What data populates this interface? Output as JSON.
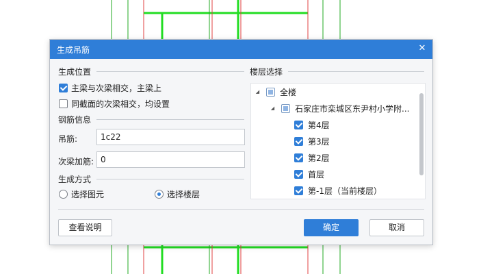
{
  "dialog": {
    "title": "生成吊筋",
    "close_glyph": "✕"
  },
  "position_group": {
    "title": "生成位置",
    "options": [
      {
        "label": "主梁与次梁相交，主梁上",
        "checked": true
      },
      {
        "label": "同截面的次梁相交，均设置",
        "checked": false
      }
    ]
  },
  "rebar_group": {
    "title": "钢筋信息",
    "hanger": {
      "label": "吊筋:",
      "value": "1c22"
    },
    "secondary": {
      "label": "次梁加筋:",
      "value": "0"
    }
  },
  "method_group": {
    "title": "生成方式",
    "options": [
      {
        "label": "选择图元",
        "selected": false
      },
      {
        "label": "选择楼层",
        "selected": true
      }
    ]
  },
  "floor_group": {
    "title": "楼层选择",
    "root": {
      "label": "全楼",
      "state": "partial",
      "expanded_glyph": "◢"
    },
    "project": {
      "label": "石家庄市栾城区东尹村小学附...",
      "state": "partial",
      "expanded_glyph": "◢"
    },
    "floors": [
      {
        "label": "第4层",
        "checked": true
      },
      {
        "label": "第3层",
        "checked": true
      },
      {
        "label": "第2层",
        "checked": true
      },
      {
        "label": "首层",
        "checked": true
      },
      {
        "label": "第-1层（当前楼层）",
        "checked": true
      }
    ]
  },
  "buttons": {
    "help": "查看说明",
    "ok": "确定",
    "cancel": "取消"
  },
  "colors": {
    "accent": "#2f7ed8",
    "cad_green": "#22dd22",
    "cad_red": "#e04040"
  }
}
